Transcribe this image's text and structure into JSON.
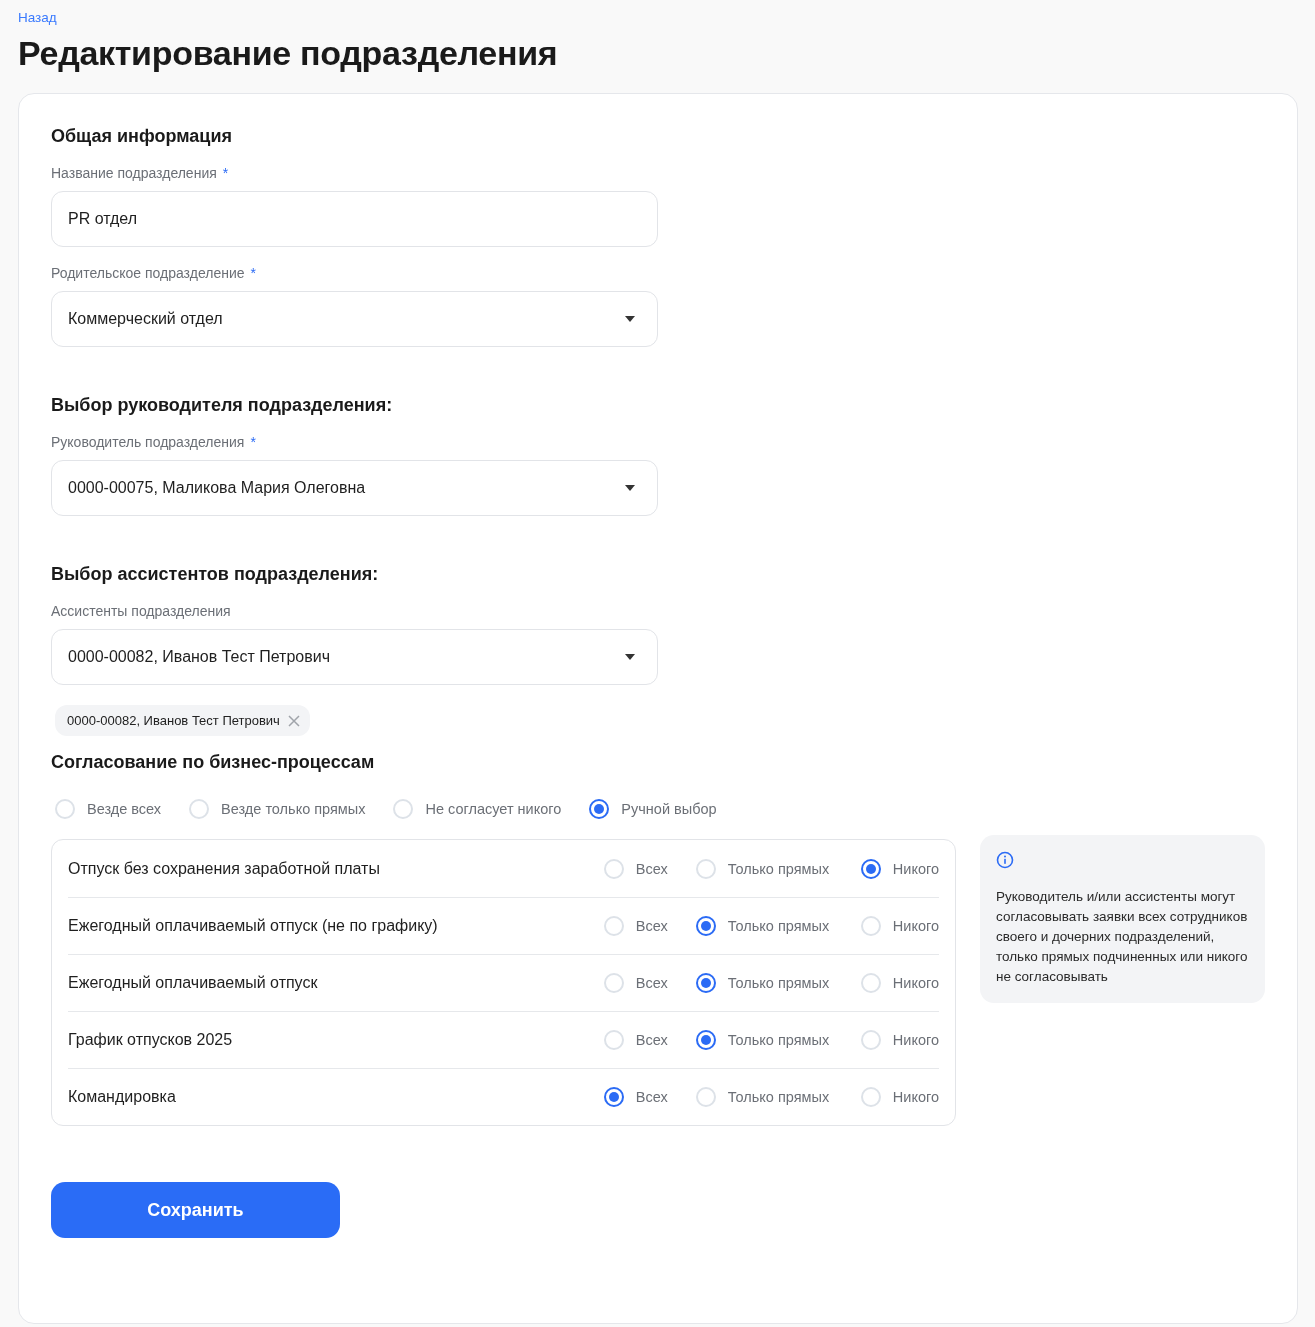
{
  "back_link": "Назад",
  "title": "Редактирование подразделения",
  "general": {
    "heading": "Общая информация",
    "fields": [
      {
        "label": "Название подразделения",
        "required_mark": "*",
        "value": "PR отдел",
        "kind": "text"
      },
      {
        "label": "Родительское подразделение",
        "required_mark": "*",
        "value": "Коммерческий отдел",
        "kind": "select"
      }
    ]
  },
  "head": {
    "heading": "Выбор руководителя подразделения:",
    "fields": [
      {
        "label": "Руководитель подразделения",
        "required_mark": "*",
        "value": "0000-00075, Маликова Мария Олеговна",
        "kind": "select"
      }
    ]
  },
  "assistants": {
    "heading": "Выбор ассистентов подразделения:",
    "fields": [
      {
        "label": "Ассистенты подразделения",
        "value": "0000-00082, Иванов Тест Петрович",
        "kind": "select"
      }
    ],
    "tags": [
      {
        "label": "0000-00082, Иванов Тест Петрович"
      }
    ]
  },
  "approval": {
    "heading": "Согласование по бизнес-процессам",
    "modes": [
      {
        "label": "Везде всех",
        "selected": false
      },
      {
        "label": "Везде только прямых",
        "selected": false
      },
      {
        "label": "Не согласует никого",
        "selected": false
      },
      {
        "label": "Ручной выбор",
        "selected": true
      }
    ],
    "rows": [
      {
        "name": "Отпуск без сохранения заработной платы",
        "options": [
          {
            "label": "Всех",
            "selected": false
          },
          {
            "label": "Только прямых",
            "selected": false
          },
          {
            "label": "Никого",
            "selected": true
          }
        ]
      },
      {
        "name": "Ежегодный оплачиваемый отпуск (не по графику)",
        "options": [
          {
            "label": "Всех",
            "selected": false
          },
          {
            "label": "Только прямых",
            "selected": true
          },
          {
            "label": "Никого",
            "selected": false
          }
        ]
      },
      {
        "name": "Ежегодный оплачиваемый отпуск",
        "options": [
          {
            "label": "Всех",
            "selected": false
          },
          {
            "label": "Только прямых",
            "selected": true
          },
          {
            "label": "Никого",
            "selected": false
          }
        ]
      },
      {
        "name": "График отпусков 2025",
        "options": [
          {
            "label": "Всех",
            "selected": false
          },
          {
            "label": "Только прямых",
            "selected": true
          },
          {
            "label": "Никого",
            "selected": false
          }
        ]
      },
      {
        "name": "Командировка",
        "options": [
          {
            "label": "Всех",
            "selected": true
          },
          {
            "label": "Только прямых",
            "selected": false
          },
          {
            "label": "Никого",
            "selected": false
          }
        ]
      }
    ],
    "info": "Руководитель и/или ассистенты могут согласовывать заявки всех сотрудников своего и дочерних подразделений, только прямых подчиненных или никого не согласовывать"
  },
  "save_button": "Сохранить"
}
